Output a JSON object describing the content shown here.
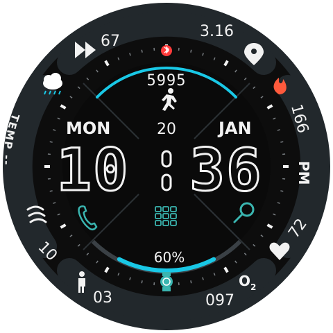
{
  "colors": {
    "background": "#0d0d0d",
    "ring": "#22282c",
    "accent": "#19c8e6",
    "teal": "#3ab5b0",
    "white": "#f2f2f2",
    "heart_rate_icon": "#ff3b3b"
  },
  "top_left": {
    "value": "67",
    "icon": "play-forward-icon"
  },
  "top_right": {
    "value": "3.16",
    "icon": "location-pin-icon"
  },
  "top_center_icon": "bluetooth-icon",
  "weather": {
    "icon": "rain-cloud-icon",
    "label": "TEMP --"
  },
  "wind": {
    "value": "10",
    "icon": "wind-icon"
  },
  "calories": {
    "value": "166",
    "icon": "flame-icon"
  },
  "heart_rate": {
    "value": "72",
    "icon": "heart-icon"
  },
  "steps": {
    "value": "5995",
    "icon": "running-man-icon"
  },
  "date": {
    "day_of_week": "MON",
    "day": "20",
    "month": "JAN"
  },
  "time": {
    "hours": "10",
    "minutes": "36",
    "ampm": "PM"
  },
  "shortcuts": {
    "left": "phone-icon",
    "center": "app-grid-icon",
    "right": "search-icon"
  },
  "battery": {
    "percent_text": "60%",
    "level": 0.6
  },
  "bottom_left": {
    "value": "03",
    "icon": "person-standing-icon"
  },
  "bottom_right": {
    "value": "097",
    "icon": "o2-icon",
    "icon_text": "O",
    "icon_sub": "2"
  },
  "bottom_center_icon": "watch-icon"
}
